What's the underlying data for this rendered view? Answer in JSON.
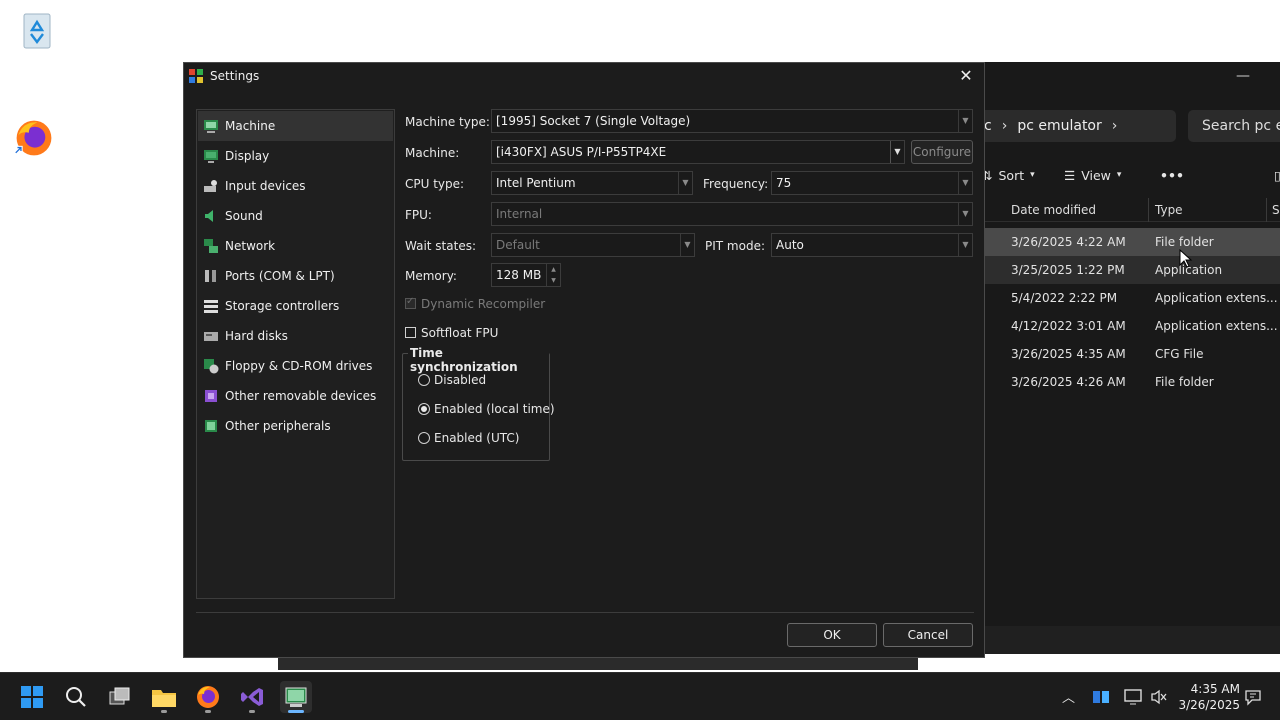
{
  "dialog": {
    "title": "Settings",
    "nav": [
      {
        "label": "Machine",
        "icon": "machine-icon"
      },
      {
        "label": "Display",
        "icon": "display-icon"
      },
      {
        "label": "Input devices",
        "icon": "input-devices-icon"
      },
      {
        "label": "Sound",
        "icon": "sound-icon"
      },
      {
        "label": "Network",
        "icon": "network-icon"
      },
      {
        "label": "Ports (COM & LPT)",
        "icon": "ports-icon"
      },
      {
        "label": "Storage controllers",
        "icon": "storage-icon"
      },
      {
        "label": "Hard disks",
        "icon": "hard-disk-icon"
      },
      {
        "label": "Floppy & CD-ROM drives",
        "icon": "floppy-cdrom-icon"
      },
      {
        "label": "Other removable devices",
        "icon": "removable-devices-icon"
      },
      {
        "label": "Other peripherals",
        "icon": "peripherals-icon"
      }
    ],
    "machine": {
      "machine_type_label": "Machine type:",
      "machine_type_value": "[1995] Socket 7 (Single Voltage)",
      "machine_label": "Machine:",
      "machine_value": "[i430FX] ASUS P/I-P55TP4XE",
      "configure_label": "Configure",
      "cpu_type_label": "CPU type:",
      "cpu_type_value": "Intel Pentium",
      "frequency_label": "Frequency:",
      "frequency_value": "75",
      "fpu_label": "FPU:",
      "fpu_value": "Internal",
      "wait_states_label": "Wait states:",
      "wait_states_value": "Default",
      "pit_mode_label": "PIT mode:",
      "pit_mode_value": "Auto",
      "memory_label": "Memory:",
      "memory_value": "128 MB",
      "dynamic_recompiler_label": "Dynamic Recompiler",
      "softfloat_label": "Softfloat FPU",
      "time_sync": {
        "title": "Time synchronization",
        "options": [
          "Disabled",
          "Enabled (local time)",
          "Enabled (UTC)"
        ],
        "selected": "Enabled (local time)"
      }
    },
    "ok_label": "OK",
    "cancel_label": "Cancel"
  },
  "explorer": {
    "breadcrumb_partial": "c",
    "breadcrumb_current": "pc emulator",
    "search_placeholder": "Search pc em",
    "sort_label": "Sort",
    "view_label": "View",
    "more_label": "•••",
    "columns": [
      "Date modified",
      "Type",
      "S"
    ],
    "rows": [
      {
        "date": "3/26/2025 4:22 AM",
        "type": "File folder"
      },
      {
        "date": "3/25/2025 1:22 PM",
        "type": "Application"
      },
      {
        "date": "5/4/2022 2:22 PM",
        "type": "Application extens..."
      },
      {
        "date": "4/12/2022 3:01 AM",
        "type": "Application extens..."
      },
      {
        "date": "3/26/2025 4:35 AM",
        "type": "CFG File"
      },
      {
        "date": "3/26/2025 4:26 AM",
        "type": "File folder"
      }
    ]
  },
  "taskbar": {
    "time": "4:35 AM",
    "date": "3/26/2025"
  },
  "colors": {
    "dialog_bg": "#1c1c1c",
    "taskbar_bg": "#1c1c1c",
    "windows_blue": "#2f9bf4"
  }
}
